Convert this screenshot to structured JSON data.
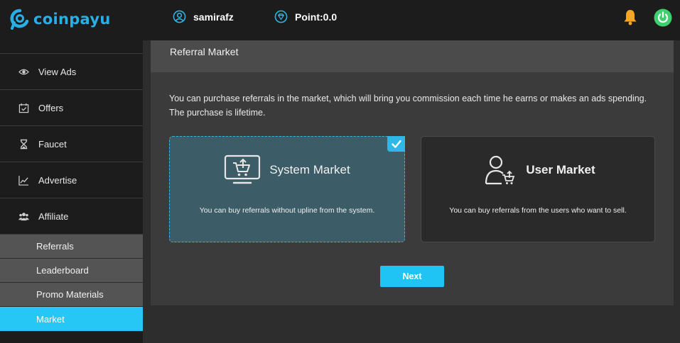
{
  "brand": {
    "name": "coinpayu",
    "color": "#2aaee6"
  },
  "header": {
    "username": "samirafz",
    "points": "Point:0.0",
    "icons": [
      "user-circle-icon",
      "diamond-icon",
      "bell-icon",
      "power-icon"
    ]
  },
  "sidebar": {
    "items": [
      {
        "label": "View Ads",
        "icon": "eye-icon"
      },
      {
        "label": "Offers",
        "icon": "calendar-check-icon"
      },
      {
        "label": "Faucet",
        "icon": "hourglass-icon"
      },
      {
        "label": "Advertise",
        "icon": "line-chart-icon"
      },
      {
        "label": "Affiliate",
        "icon": "users-icon"
      }
    ],
    "subitems": [
      {
        "label": "Referrals"
      },
      {
        "label": "Leaderboard"
      },
      {
        "label": "Promo Materials"
      },
      {
        "label": "Market",
        "active": true
      }
    ],
    "active_color": "#26c6f5"
  },
  "main": {
    "title": "Referral Market",
    "description": "You can purchase referrals in the market, which will bring you commission each time he earns or makes an ads spending. The purchase is lifetime.",
    "cards": [
      {
        "title": "System Market",
        "subtitle": "You can buy referrals without upline from the system.",
        "icon": "monitor-cart-icon",
        "selected": true
      },
      {
        "title": "User Market",
        "subtitle": "You can buy referrals from the users who want to sell.",
        "icon": "user-cart-icon",
        "selected": false
      }
    ],
    "next_label": "Next"
  }
}
